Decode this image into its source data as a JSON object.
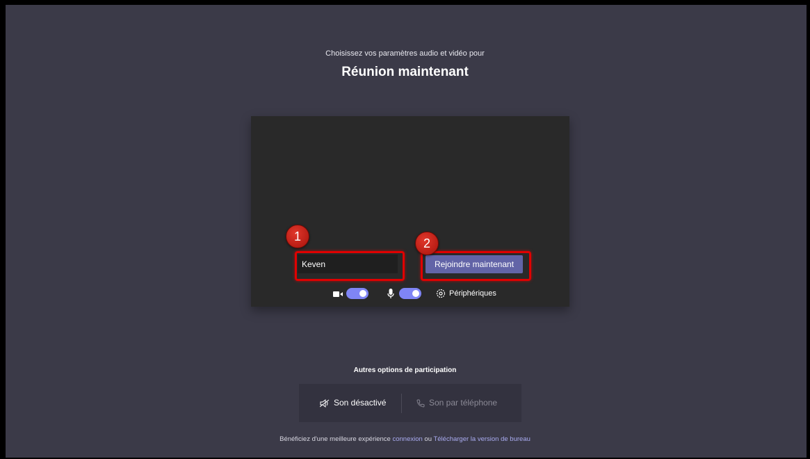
{
  "header": {
    "subtitle": "Choisissez vos paramètres audio et vidéo pour",
    "meeting_title": "Réunion maintenant"
  },
  "prejoin": {
    "name_value": "Keven",
    "join_label": "Rejoindre maintenant",
    "camera_on": true,
    "mic_on": true,
    "devices_label": "Périphériques"
  },
  "annotations": {
    "badge_1": "1",
    "badge_2": "2"
  },
  "other_options": {
    "title": "Autres options de participation",
    "audio_off_label": "Son désactivé",
    "phone_label": "Son par téléphone"
  },
  "footer": {
    "prefix": "Bénéficiez d'une meilleure expérience",
    "link_connexion": "connexion",
    "middle": "ou",
    "link_download": "Télécharger la version de bureau"
  },
  "colors": {
    "background": "#3b3a48",
    "accent": "#6264a7",
    "toggle_on": "#7f85f5",
    "annotation_red": "#e00000"
  }
}
